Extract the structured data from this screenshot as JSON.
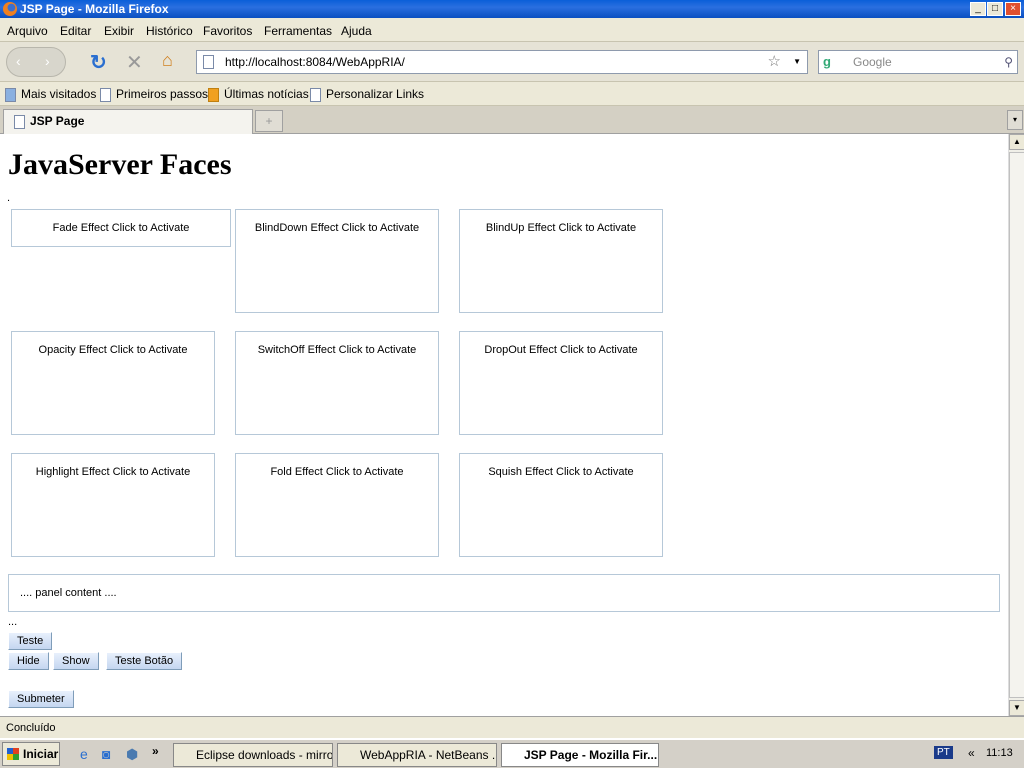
{
  "window": {
    "title": "JSP Page - Mozilla Firefox"
  },
  "menu": [
    "Arquivo",
    "Editar",
    "Exibir",
    "Histórico",
    "Favoritos",
    "Ferramentas",
    "Ajuda"
  ],
  "nav": {
    "url": "http://localhost:8084/WebAppRIA/",
    "search_placeholder": "Google"
  },
  "bookmarks": [
    "Mais visitados",
    "Primeiros passos",
    "Últimas notícias",
    "Personalizar Links"
  ],
  "tab": {
    "label": "JSP Page"
  },
  "page": {
    "heading": "JavaServer Faces",
    "dot": ".",
    "effects": [
      "Fade Effect Click to Activate",
      "BlindDown Effect Click to Activate",
      "BlindUp Effect Click to Activate",
      "Opacity Effect Click to Activate",
      "SwitchOff Effect Click to Activate",
      "DropOut Effect Click to Activate",
      "Highlight Effect Click to Activate",
      "Fold Effect Click to Activate",
      "Squish Effect Click to Activate"
    ],
    "panel": ".... panel content ....",
    "ellipsis": "...",
    "buttons": {
      "teste": "Teste",
      "hide": "Hide",
      "show": "Show",
      "teste_botao": "Teste Botão",
      "submeter": "Submeter"
    }
  },
  "status": "Concluído",
  "taskbar": {
    "start": "Iniciar",
    "tasks": [
      "Eclipse downloads - mirro...",
      "WebAppRIA - NetBeans ...",
      "JSP Page - Mozilla Fir..."
    ],
    "lang": "PT",
    "clock": "11:13"
  }
}
